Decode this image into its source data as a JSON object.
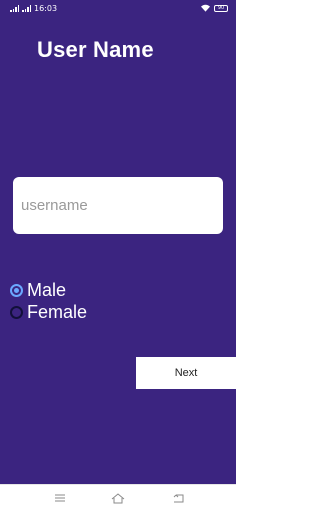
{
  "status_bar": {
    "time": "16:03",
    "battery": "90",
    "icons": [
      "signal-icon",
      "signal-icon",
      "wifi-icon",
      "battery-icon"
    ]
  },
  "page": {
    "title": "User Name"
  },
  "form": {
    "username_placeholder": "username",
    "username_value": "",
    "gender_options": [
      {
        "label": "Male",
        "checked": true
      },
      {
        "label": "Female",
        "checked": false
      }
    ],
    "next_label": "Next"
  },
  "nav_bar": {
    "icons": [
      "menu-icon",
      "home-icon",
      "back-icon"
    ]
  },
  "colors": {
    "background": "#3b2480",
    "radio_accent": "#6ba8ff",
    "surface": "#ffffff"
  }
}
